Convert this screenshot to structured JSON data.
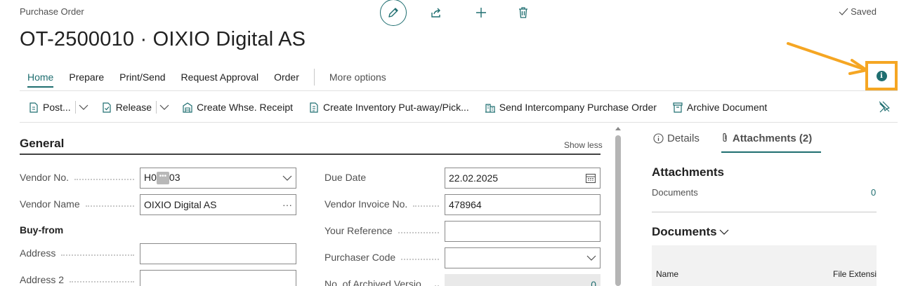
{
  "header": {
    "page_kind": "Purchase Order",
    "title": "OT-2500010 · OIXIO Digital AS",
    "saved_label": "Saved"
  },
  "tabs": [
    {
      "label": "Home",
      "active": true
    },
    {
      "label": "Prepare"
    },
    {
      "label": "Print/Send"
    },
    {
      "label": "Request Approval"
    },
    {
      "label": "Order"
    }
  ],
  "more_options_label": "More options",
  "actions": {
    "post": "Post...",
    "release": "Release",
    "whse_receipt": "Create Whse. Receipt",
    "inventory_putaway": "Create Inventory Put-away/Pick...",
    "intercompany": "Send Intercompany Purchase Order",
    "archive": "Archive Document"
  },
  "general": {
    "title": "General",
    "show_less": "Show less",
    "buy_from_heading": "Buy-from",
    "left_fields": {
      "vendor_no": {
        "label": "Vendor No.",
        "value_prefix": "H0",
        "value_suffix": "03",
        "masked_glyph": "•••"
      },
      "vendor_name": {
        "label": "Vendor Name",
        "value": "OIXIO Digital AS",
        "more_glyph": "···"
      },
      "address": {
        "label": "Address",
        "value": ""
      },
      "address2": {
        "label": "Address 2",
        "value": ""
      }
    },
    "right_fields": {
      "due_date": {
        "label": "Due Date",
        "value": "22.02.2025"
      },
      "vendor_invoice_no": {
        "label": "Vendor Invoice No.",
        "value": "478964"
      },
      "your_reference": {
        "label": "Your Reference",
        "value": ""
      },
      "purchaser_code": {
        "label": "Purchaser Code",
        "value": ""
      },
      "archived_versions": {
        "label": "No. of Archived Versio...",
        "value": "0"
      }
    }
  },
  "panel": {
    "tab_details": "Details",
    "tab_attachments": "Attachments (2)",
    "attachments_title": "Attachments",
    "documents_label": "Documents",
    "documents_count": "0",
    "documents_title": "Documents",
    "col_name": "Name",
    "col_ext": "File Extension"
  },
  "colors": {
    "accent": "#1f6e70",
    "highlight": "#f5a623"
  },
  "icons": {
    "info": "info-icon",
    "edit": "pencil-icon",
    "share": "share-icon",
    "add": "plus-icon",
    "delete": "trash-icon"
  }
}
